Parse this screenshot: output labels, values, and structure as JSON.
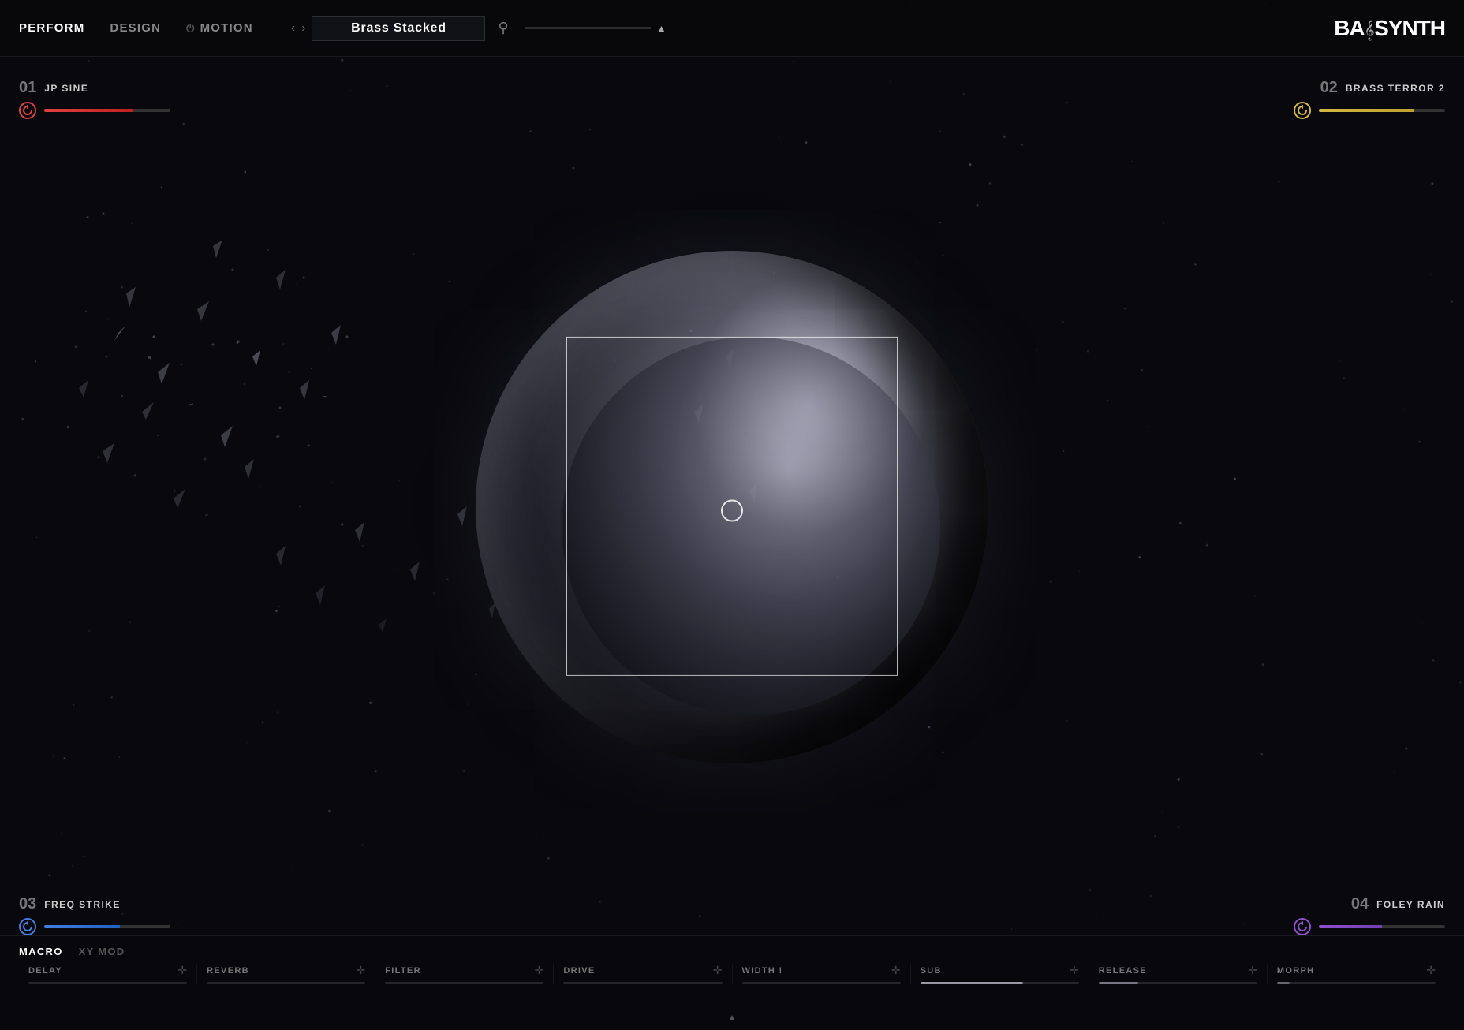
{
  "header": {
    "tabs": [
      {
        "id": "perform",
        "label": "PERFORM",
        "active": true
      },
      {
        "id": "design",
        "label": "DESIGN",
        "active": false
      },
      {
        "id": "motion",
        "label": "MOTION",
        "active": false,
        "has_icon": true
      }
    ],
    "prev_arrow": "‹",
    "next_arrow": "›",
    "preset_name": "Brass Stacked",
    "search_label": "🔍",
    "logo": "BASSYNTH"
  },
  "slots": [
    {
      "id": "slot-01",
      "number": "01",
      "name": "JP SINE",
      "power_color": "red",
      "position": "top-left"
    },
    {
      "id": "slot-02",
      "number": "02",
      "name": "BRASS TERROR 2",
      "power_color": "yellow",
      "position": "top-right"
    },
    {
      "id": "slot-03",
      "number": "03",
      "name": "FREQ STRIKE",
      "power_color": "blue",
      "position": "bottom-left"
    },
    {
      "id": "slot-04",
      "number": "04",
      "name": "FOLEY RAIN",
      "power_color": "purple",
      "position": "bottom-right"
    }
  ],
  "bottom": {
    "tabs": [
      {
        "label": "MACRO",
        "active": true
      },
      {
        "label": "XY MOD",
        "active": false
      }
    ],
    "sliders": [
      {
        "label": "DELAY",
        "fill": 0
      },
      {
        "label": "REVERB",
        "fill": 0
      },
      {
        "label": "FILTER",
        "fill": 0
      },
      {
        "label": "DRIVE",
        "fill": 0
      },
      {
        "label": "WIDTH !",
        "fill": 0
      },
      {
        "label": "SUB",
        "fill": 65
      },
      {
        "label": "RELEASE",
        "fill": 25
      },
      {
        "label": "MORPH",
        "fill": 8
      }
    ],
    "drag_icon": "✛"
  }
}
